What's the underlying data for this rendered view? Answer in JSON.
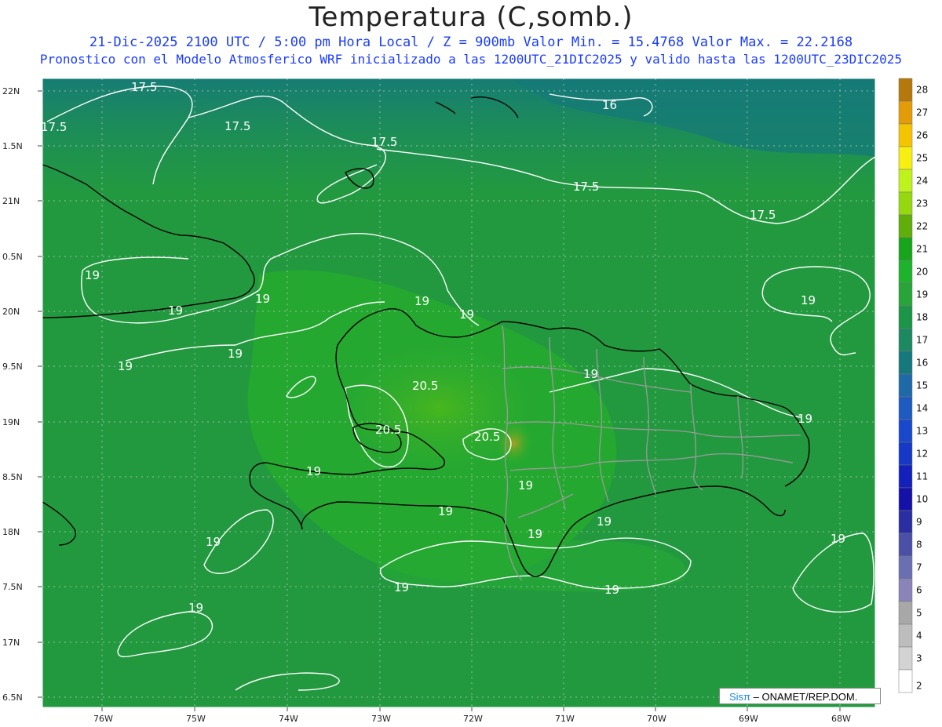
{
  "title": "Temperatura (C,somb.)",
  "subtitle_line1": "21-Dic-2025  2100 UTC / 5:00 pm Hora Local / Z = 900mb   Valor Min. = 15.4768  Valor Max. = 22.2168",
  "subtitle_line2": "Pronostico con el Modelo Atmosferico WRF inicializado a las 1200UTC_21DIC2025 y valido hasta las  1200UTC_23DIC2025",
  "lon_labels": [
    "76W",
    "75W",
    "74W",
    "73W",
    "72W",
    "71W",
    "70W",
    "69W",
    "68W"
  ],
  "lat_labels": [
    "22N",
    "1.5N",
    "21N",
    "0.5N",
    "20N",
    "9.5N",
    "19N",
    "8.5N",
    "18N",
    "7.5N",
    "17N",
    "6.5N"
  ],
  "colorbar": {
    "labels": [
      "28",
      "27",
      "26",
      "25",
      "24",
      "23",
      "22",
      "21",
      "20",
      "19",
      "18",
      "17",
      "16",
      "15",
      "14",
      "13",
      "12",
      "11",
      "10",
      "9",
      "8",
      "7",
      "6",
      "5",
      "4",
      "3",
      "2"
    ],
    "colors": [
      "#b5780a",
      "#e39b06",
      "#f5c400",
      "#f7ef10",
      "#bff21a",
      "#95d80e",
      "#5fae0a",
      "#19a51b",
      "#1db42b",
      "#27a538",
      "#1b9548",
      "#1b8a62",
      "#14787c",
      "#1e6aa8",
      "#1d5bc3",
      "#1848cc",
      "#1638c6",
      "#1420bb",
      "#1511a8",
      "#2a2ea0",
      "#4b4fa5",
      "#6a6fb2",
      "#8b84b8",
      "#a8a8a8",
      "#bdbdbd",
      "#d3d3d3",
      "#ffffff"
    ]
  },
  "contour_labels": [
    "17.5",
    "17.5",
    "17.5",
    "17.5",
    "17.5",
    "17.5",
    "16",
    "19",
    "19",
    "19",
    "19",
    "19",
    "19",
    "19",
    "19",
    "19",
    "19",
    "19",
    "19",
    "19",
    "19",
    "19",
    "19",
    "19",
    "20.5",
    "20.5",
    "20.5"
  ],
  "credit": {
    "sis": "Sisπ",
    "rest": "– ONAMET/REP.DOM."
  }
}
